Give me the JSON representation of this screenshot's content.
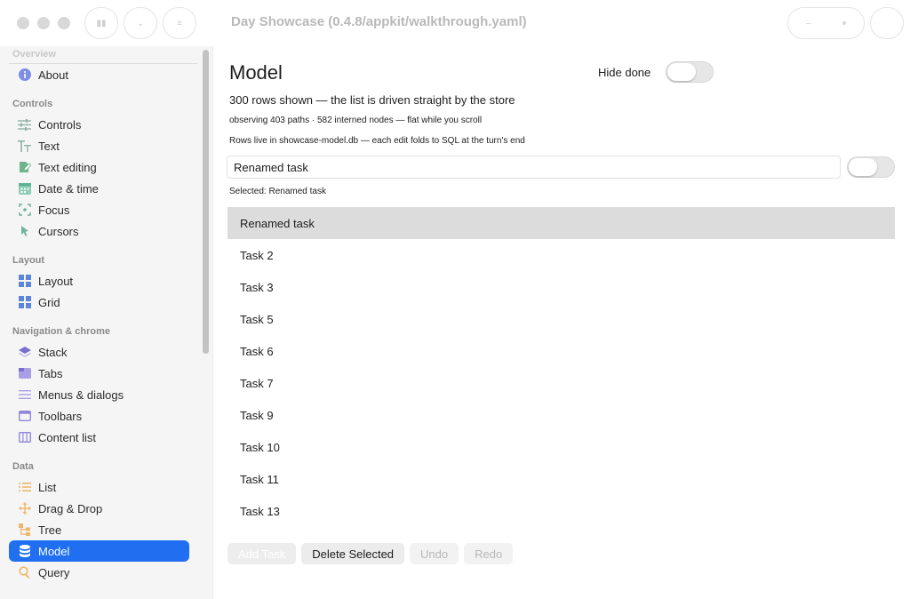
{
  "window": {
    "title": "Day Showcase (0.4.8/appkit/walkthrough.yaml)",
    "toolbar_left": [
      {
        "icon": "pause-icon",
        "glyph": "▮▮"
      },
      {
        "icon": "chevron-icon",
        "glyph": "⌄"
      },
      {
        "icon": "menu-icon",
        "glyph": "≡"
      }
    ]
  },
  "sidebar": {
    "sections": [
      {
        "label": "Overview",
        "items": [
          {
            "label": "About",
            "icon": "info-icon"
          }
        ]
      },
      {
        "label": "Controls",
        "items": [
          {
            "label": "Controls",
            "icon": "sliders-icon"
          },
          {
            "label": "Text",
            "icon": "text-icon"
          },
          {
            "label": "Text editing",
            "icon": "edit-icon"
          },
          {
            "label": "Date & time",
            "icon": "calendar-icon"
          },
          {
            "label": "Focus",
            "icon": "focus-icon"
          },
          {
            "label": "Cursors",
            "icon": "cursor-icon"
          }
        ]
      },
      {
        "label": "Layout",
        "items": [
          {
            "label": "Layout",
            "icon": "layout-icon"
          },
          {
            "label": "Grid",
            "icon": "grid-icon"
          }
        ]
      },
      {
        "label": "Navigation & chrome",
        "items": [
          {
            "label": "Stack",
            "icon": "stack-icon"
          },
          {
            "label": "Tabs",
            "icon": "tabs-icon"
          },
          {
            "label": "Menus & dialogs",
            "icon": "menu-lines-icon"
          },
          {
            "label": "Toolbars",
            "icon": "toolbar-icon"
          },
          {
            "label": "Content list",
            "icon": "columns-icon"
          }
        ]
      },
      {
        "label": "Data",
        "items": [
          {
            "label": "List",
            "icon": "list-icon"
          },
          {
            "label": "Drag & Drop",
            "icon": "move-icon"
          },
          {
            "label": "Tree",
            "icon": "tree-icon"
          },
          {
            "label": "Model",
            "icon": "database-icon",
            "selected": true
          },
          {
            "label": "Query",
            "icon": "magnifier-icon"
          }
        ]
      }
    ]
  },
  "main": {
    "title": "Model",
    "hide_done_label": "Hide done",
    "hide_done_on": false,
    "rows_info": "300 rows shown — the list is driven straight by the store",
    "observing_info": "observing 403 paths · 582 interned nodes — flat while you scroll",
    "storage_info": "Rows live in showcase-model.db — each edit folds to SQL at the turn's end",
    "input_value": "Renamed task",
    "input_toggle_on": false,
    "selected_text": "Selected: Renamed task",
    "tasks": [
      {
        "label": "Renamed task",
        "selected": true
      },
      {
        "label": "Task 2"
      },
      {
        "label": "Task 3"
      },
      {
        "label": "Task 5"
      },
      {
        "label": "Task 6"
      },
      {
        "label": "Task 7"
      },
      {
        "label": "Task 9"
      },
      {
        "label": "Task 10"
      },
      {
        "label": "Task 11"
      },
      {
        "label": "Task 13"
      }
    ],
    "buttons": {
      "add": "Add Task",
      "delete": "Delete Selected",
      "undo": "Undo",
      "redo": "Redo"
    }
  },
  "colors": {
    "accent": "#1f6ff0",
    "selection_row": "#dcdcdc"
  }
}
